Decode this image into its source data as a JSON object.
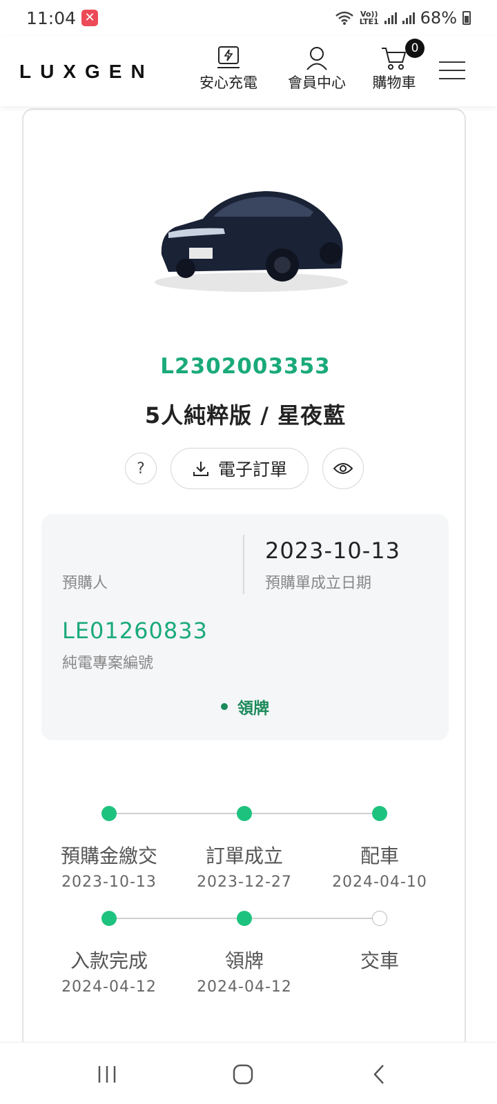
{
  "status_bar": {
    "time": "11:04",
    "lte_top": "Vo))",
    "lte_bottom": "LTE1",
    "battery": "68%"
  },
  "header": {
    "logo": "LUXGEN",
    "nav": [
      {
        "label": "安心充電",
        "icon": "charging-station-icon"
      },
      {
        "label": "會員中心",
        "icon": "user-icon"
      },
      {
        "label": "購物車",
        "icon": "cart-icon"
      }
    ],
    "cart_count": "0",
    "menu_icon": "hamburger-icon"
  },
  "order": {
    "order_number": "L2302003353",
    "model_color": "5人純粹版 / 星夜藍",
    "help_symbol": "?",
    "download_label": "電子訂單",
    "buyer_value": "",
    "buyer_label": "預購人",
    "created_date": "2023-10-13",
    "created_date_label": "預購單成立日期",
    "project_number": "LE01260833",
    "project_label": "純電專案編號",
    "current_status": "領牌"
  },
  "timeline": [
    {
      "label": "預購金繳交",
      "date": "2023-10-13",
      "done": true
    },
    {
      "label": "訂單成立",
      "date": "2023-12-27",
      "done": true
    },
    {
      "label": "配車",
      "date": "2024-04-10",
      "done": true
    },
    {
      "label": "入款完成",
      "date": "2024-04-12",
      "done": true
    },
    {
      "label": "領牌",
      "date": "2024-04-12",
      "done": true
    },
    {
      "label": "交車",
      "date": "",
      "done": false
    }
  ],
  "colors": {
    "accent_green": "#1aaa7a",
    "status_green": "#1b8a5a",
    "timeline_dot": "#1ec27f"
  }
}
